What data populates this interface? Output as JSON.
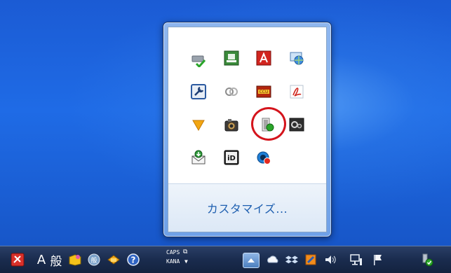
{
  "flyout": {
    "customize_label": "カスタマイズ..."
  },
  "tray_icons": [
    {
      "name": "drive-check-icon"
    },
    {
      "name": "green-box-icon"
    },
    {
      "name": "adobe-icon"
    },
    {
      "name": "network-globe-icon"
    },
    {
      "name": "wrench-icon"
    },
    {
      "name": "rings-icon"
    },
    {
      "name": "ccu-icon"
    },
    {
      "name": "acrobat-icon"
    },
    {
      "name": "triangle-icon"
    },
    {
      "name": "camera-icon"
    },
    {
      "name": "device-green-icon"
    },
    {
      "name": "dark-gear-icon"
    },
    {
      "name": "mail-download-icon"
    },
    {
      "name": "id-icon"
    },
    {
      "name": "blue-circle-alert-icon"
    }
  ],
  "taskbar": {
    "ime_mode": "A",
    "ime_kanji": "般",
    "caps_label": "CAPS",
    "kana_label": "KANA",
    "help_glyph": "?"
  },
  "colors": {
    "desktop_blue": "#1f5fd0",
    "highlight_red": "#d4141c",
    "link_blue": "#1e5fb0"
  }
}
